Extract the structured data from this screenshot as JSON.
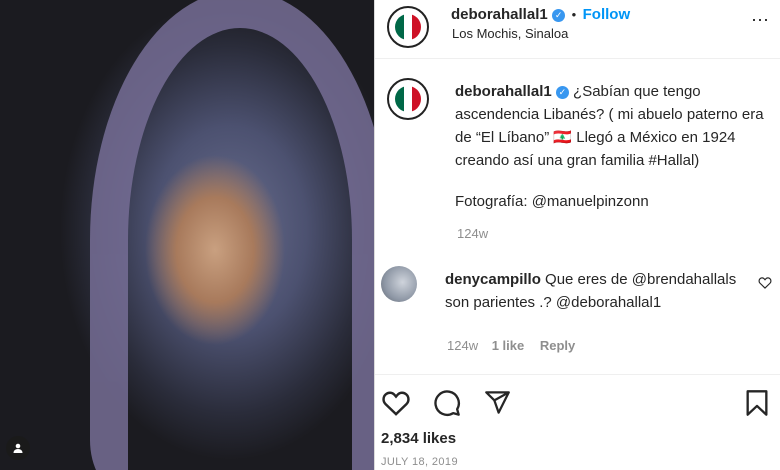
{
  "post_header": {
    "username": "deborahallal1",
    "follow_label": "Follow",
    "separator": "•",
    "location": "Los Mochis, Sinaloa"
  },
  "caption": {
    "username": "deborahallal1",
    "text": "¿Sabían que tengo ascendencia Libanés? ( mi abuelo paterno era de “El Líbano” 🇱🇧 Llegó a México en 1924 creando así una gran familia #Hallal)",
    "credit": "Fotografía: @manuelpinzonn",
    "time": "124w"
  },
  "comment": {
    "username": "denycampillo",
    "text": "Que eres de @brendahallals son parientes .? @deborahallal1",
    "time": "124w",
    "likes": "1 like",
    "reply_label": "Reply"
  },
  "stats": {
    "likes": "2,834 likes",
    "date": "JULY 18, 2019"
  },
  "icons": {
    "like": "heart-icon",
    "comment": "comment-icon",
    "share": "paper-plane-icon",
    "save": "bookmark-icon",
    "tag": "person-tag-icon"
  },
  "colors": {
    "link": "#0095f6",
    "verified": "#3897f0",
    "meta": "#8e8e8e"
  }
}
